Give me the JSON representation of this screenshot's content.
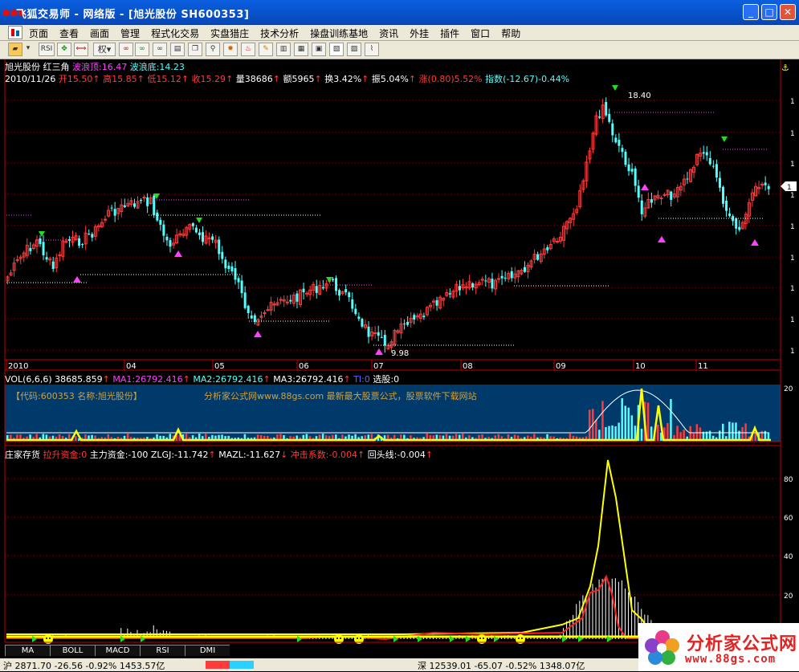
{
  "window": {
    "title": "飞狐交易师 - 网络版 - [旭光股份 SH600353]",
    "app_icon": "dots-icon"
  },
  "menu": [
    "页面",
    "查看",
    "画面",
    "管理",
    "程式化交易",
    "实盘猎庄",
    "技术分析",
    "操盘训练基地",
    "资讯",
    "外挂",
    "插件",
    "窗口",
    "帮助"
  ],
  "toolbar": {
    "quan_label": "权",
    "rsi_label": "RSI"
  },
  "main_panel": {
    "stock_name": "旭光股份",
    "indicator_name": "红三角",
    "wave_top_label": "波浪顶:16.47",
    "wave_bottom_label": "波浪底:14.23",
    "date": "2010/11/26",
    "open": "开15.50",
    "high": "高15.85",
    "low": "低15.12",
    "close": "收15.29",
    "volume": "量38686",
    "amount": "额5965",
    "turnover": "换3.42%",
    "amplitude": "振5.04%",
    "change": "涨(0.80)5.52%",
    "index": "指数(-12.67)-0.44%",
    "peak_label": "18.40",
    "trough_label": "9.98",
    "x_ticks": [
      "2010",
      "04",
      "05",
      "06",
      "07",
      "08",
      "09",
      "10",
      "11"
    ],
    "y_ticks": [
      "1",
      "1",
      "1",
      "1",
      "1",
      "1",
      "1",
      "1",
      "1"
    ],
    "price_marker": "1"
  },
  "vol_panel": {
    "vol": "VOL(6,6,6) 38685.859",
    "ma1": "MA1:26792.416",
    "ma2": "MA2:26792.416",
    "ma3": "MA3:26792.416",
    "ti": "TI:0",
    "select": "选股:0",
    "code_text": "【代码:600353 名称:旭光股份】",
    "ad_text": "分析家公式网www.88gs.com 最新最大股票公式，股票软件下载网站",
    "y_tick": "20"
  },
  "ind_panel": {
    "name": "庄家存货",
    "lift": "拉升资金:0",
    "main": "主力资金:-100",
    "zlgj": "ZLGJ:-11.742",
    "mazl": "MAZL:-11.627",
    "impact": "冲击系数:-0.004",
    "pullback": "回头线:-0.004",
    "y_ticks": [
      "80",
      "60",
      "40",
      "20"
    ]
  },
  "tabs": [
    "MA",
    "BOLL",
    "MACD",
    "RSI",
    "DMI"
  ],
  "statusbar": {
    "sh": "沪 2871.70 -26.56 -0.92% 1453.57亿",
    "sz": "深 12539.01 -65.07 -0.52% 1348.07亿"
  },
  "logo": {
    "name": "分析家公式网",
    "url": "www.88gs.com"
  },
  "colors": {
    "up": "#ff3b3b",
    "down": "#54ffff",
    "line_yellow": "#ffff00",
    "magenta": "#ff40ff",
    "green": "#22dd22"
  },
  "chart_data": {
    "type": "candlestick",
    "peak": 18.4,
    "trough": 9.98,
    "high_point": 18.4,
    "low_point": 9.98
  }
}
